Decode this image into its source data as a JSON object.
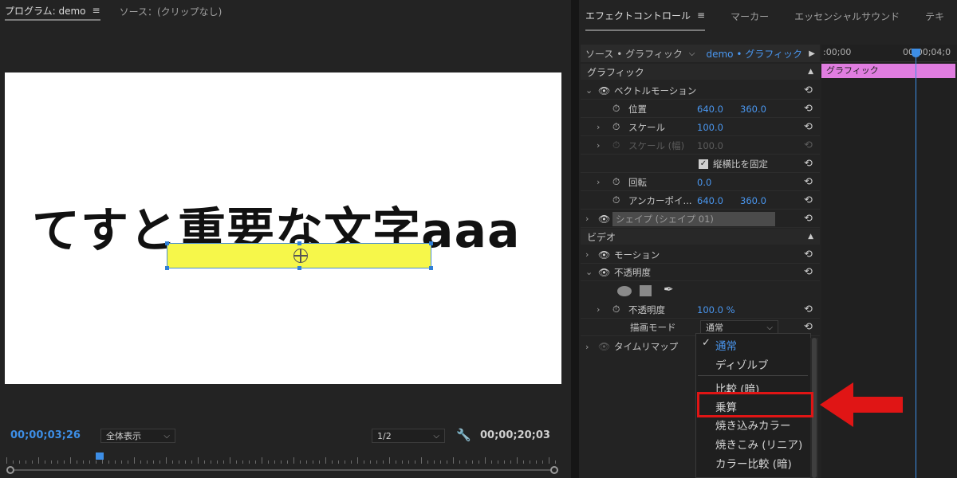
{
  "program": {
    "tab_program": "プログラム: demo",
    "tab_source": "ソース：(クリップなし)",
    "menu_glyph": "≡",
    "canvas_text": "てすと重要な文字aaa",
    "current_time": "00;00;03;26",
    "zoom_label": "全体表示",
    "resolution": "1/2",
    "duration": "00;00;20;03"
  },
  "effects": {
    "tabs": [
      "エフェクトコントロール",
      "マーカー",
      "エッセンシャルサウンド",
      "テキ"
    ],
    "source_label": "ソース • グラフィック",
    "source_selected": "demo • グラフィック",
    "section_graphic": "グラフィック",
    "section_video": "ビデオ",
    "vector_motion": "ベクトルモーション",
    "position": {
      "name": "位置",
      "x": "640.0",
      "y": "360.0"
    },
    "scale": {
      "name": "スケール",
      "value": "100.0"
    },
    "scale_width": {
      "name": "スケール (幅)",
      "value": "100.0"
    },
    "lock_ratio": "縦横比を固定",
    "rotation": {
      "name": "回転",
      "value": "0.0"
    },
    "anchor": {
      "name": "アンカーポイ...",
      "x": "640.0",
      "y": "360.0"
    },
    "shape_layer": "シェイプ (シェイプ 01)",
    "motion": "モーション",
    "opacity_group": "不透明度",
    "opacity": {
      "name": "不透明度",
      "value": "100.0 %"
    },
    "blend_mode": {
      "name": "描画モード",
      "value": "通常"
    },
    "time_remap": "タイムリマップ"
  },
  "timeline": {
    "ruler_start": ":00;00",
    "ruler_mid": "00;00;04;0",
    "clip_label": "グラフィック"
  },
  "blend_menu": {
    "items": [
      "通常",
      "ディゾルブ",
      "比較 (暗)",
      "乗算",
      "焼き込みカラー",
      "焼きこみ (リニア)",
      "カラー比較 (暗)"
    ],
    "selected": "通常",
    "highlighted": "乗算"
  },
  "colors": {
    "accent_blue": "#4a97f0",
    "clip_pink": "#e07de0",
    "shape_yellow": "#f6f74a",
    "annotation_red": "#e01515"
  }
}
